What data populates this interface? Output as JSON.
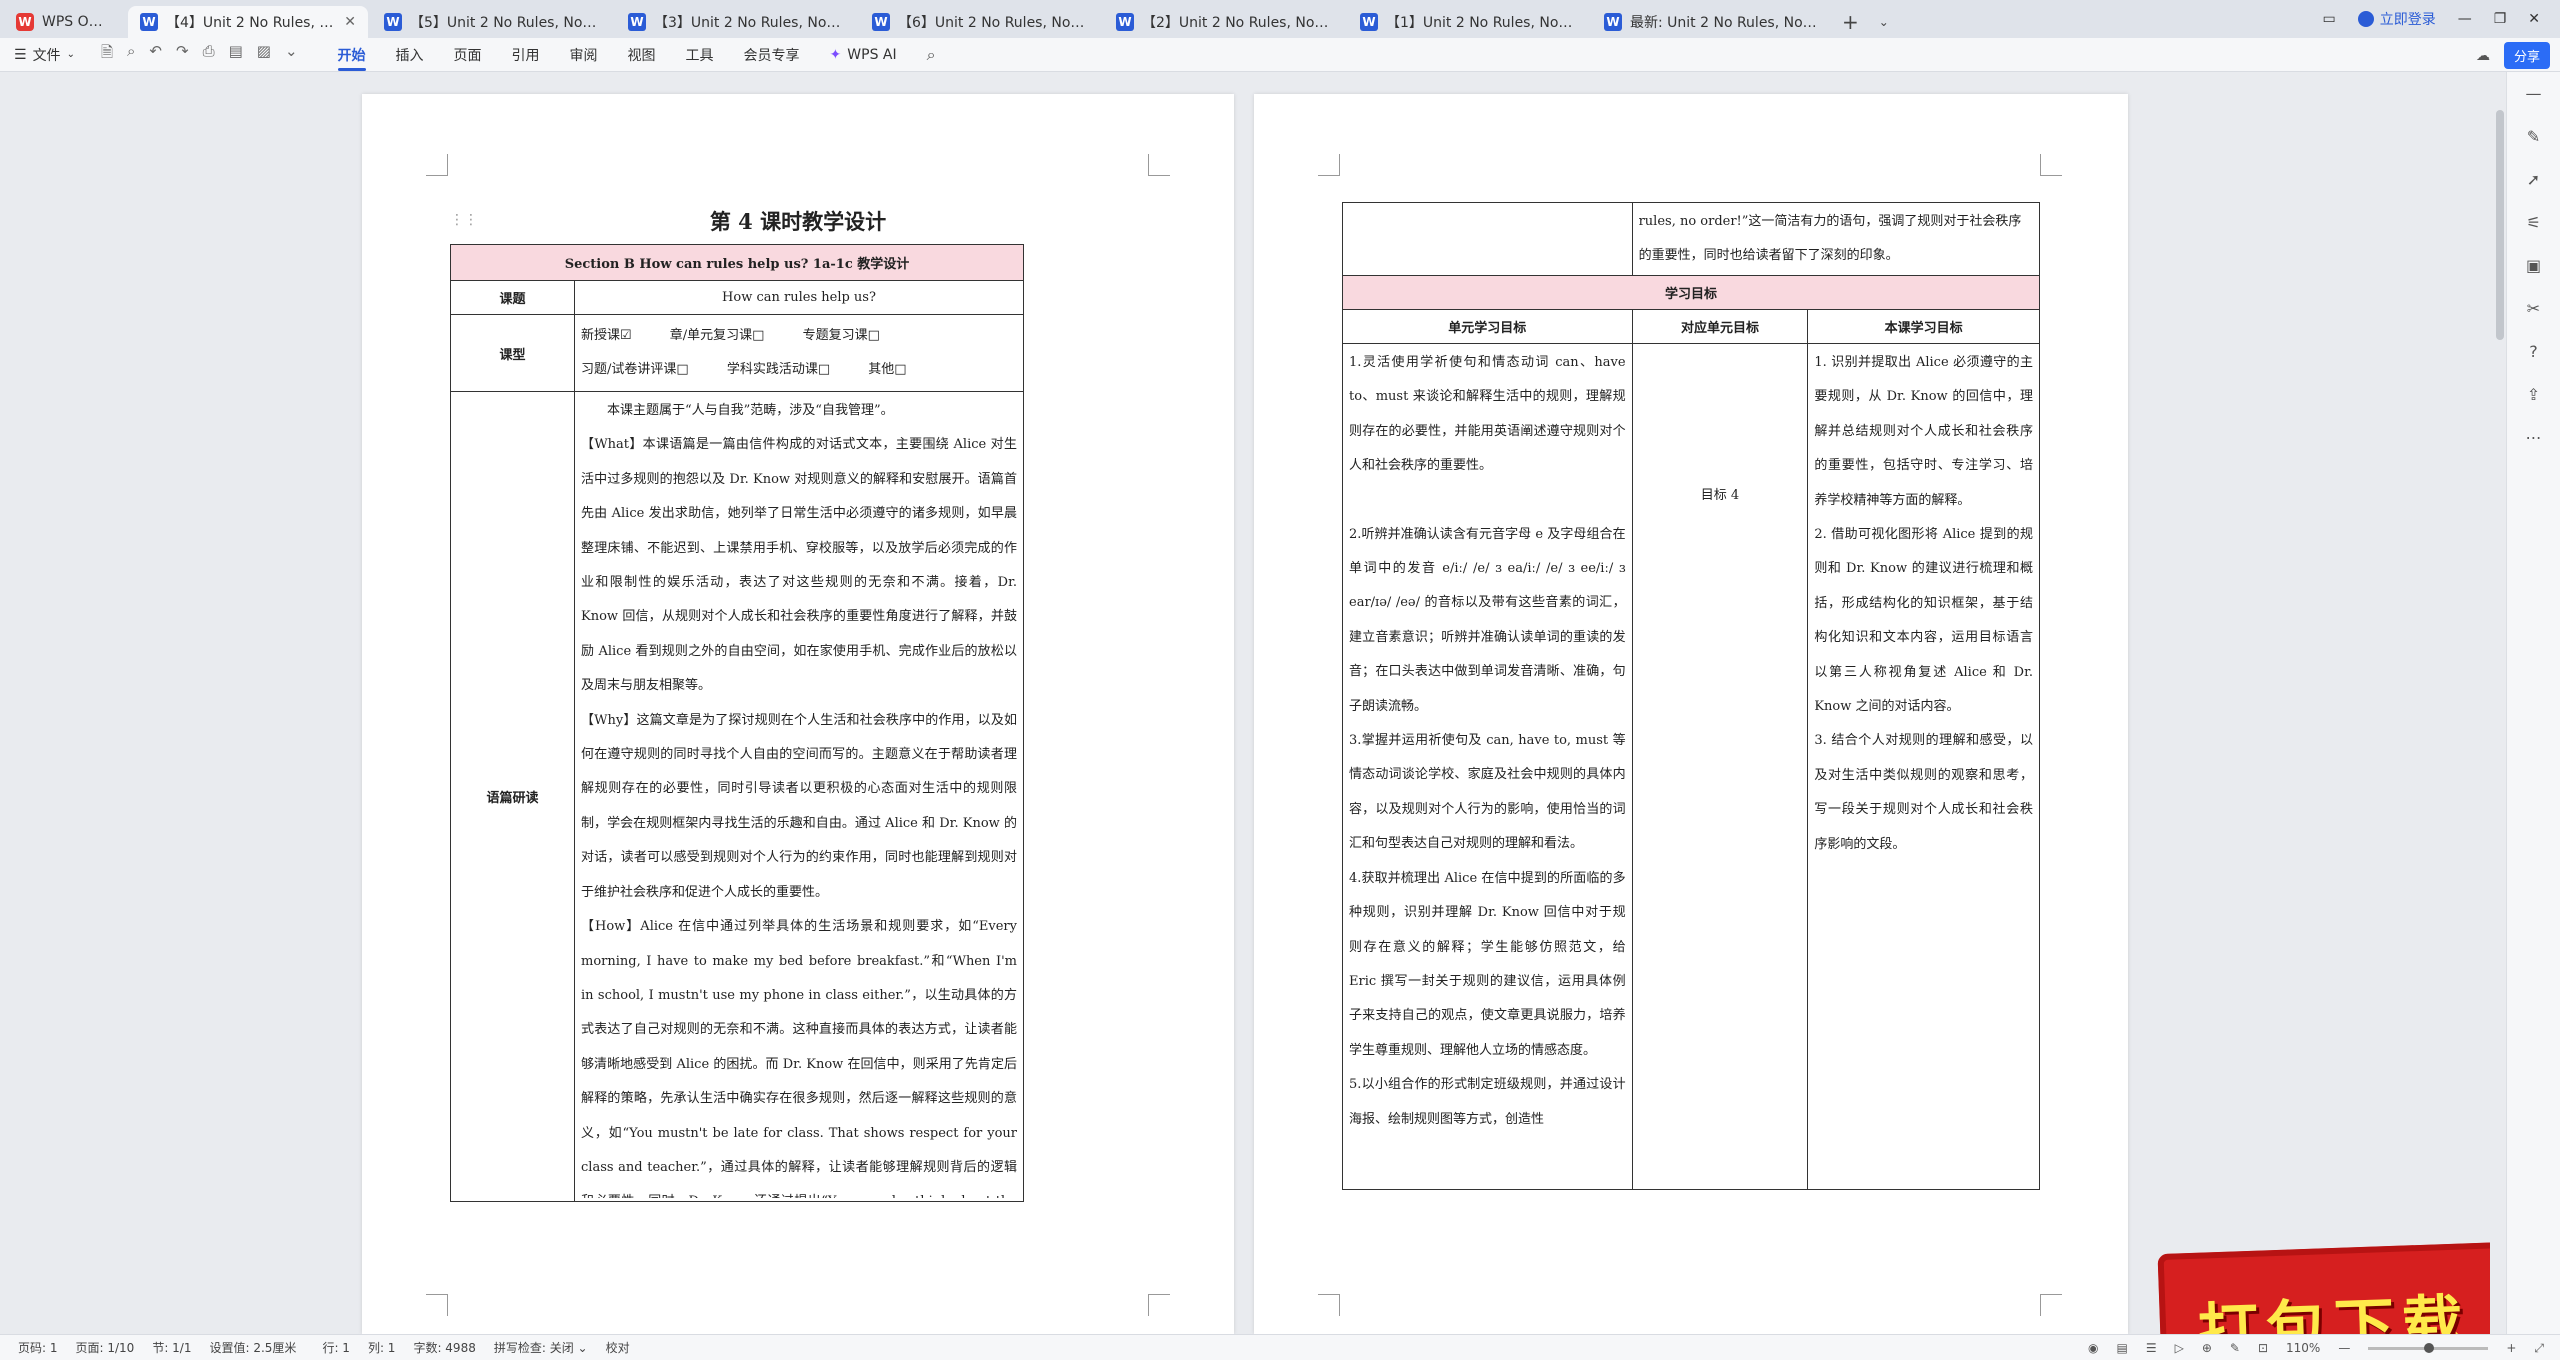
{
  "tabs": [
    {
      "label": "WPS Office",
      "kind": "app",
      "active": false
    },
    {
      "label": "【4】Unit 2 No Rules, No O",
      "kind": "doc",
      "active": true
    },
    {
      "label": "【5】Unit 2 No Rules, No Order",
      "kind": "doc",
      "active": false
    },
    {
      "label": "【3】Unit 2 No Rules, No Order",
      "kind": "doc",
      "active": false
    },
    {
      "label": "【6】Unit 2 No Rules, No Order",
      "kind": "doc",
      "active": false
    },
    {
      "label": "【2】Unit 2 No Rules, No Order",
      "kind": "doc",
      "active": false
    },
    {
      "label": "【1】Unit 2 No Rules, No Order",
      "kind": "doc",
      "active": false
    },
    {
      "label": "最新: Unit 2 No Rules, No Order",
      "kind": "doc",
      "active": false
    }
  ],
  "login_label": "立即登录",
  "share_label": "分享",
  "ribbon": {
    "file_label": "文件",
    "tabs": [
      "开始",
      "插入",
      "页面",
      "引用",
      "审阅",
      "视图",
      "工具",
      "会员专享"
    ],
    "active_tab": "开始",
    "ai_label": "WPS AI"
  },
  "page1": {
    "title": "第 4 课时教学设计",
    "table_header": "Section B How can rules help us? 1a-1c 教学设计",
    "topic_label": "课题",
    "topic_value": "How can rules help us?",
    "type_label": "课型",
    "type_line1": [
      "新授课☑",
      "章/单元复习课□",
      "专题复习课□"
    ],
    "type_line2": [
      "习题/试卷讲评课□",
      "学科实践活动课□",
      "其他□"
    ],
    "analysis_label": "语篇研读",
    "analysis_paragraphs": [
      "　　本课主题属于“人与自我”范畴，涉及“自我管理”。",
      "【What】本课语篇是一篇由信件构成的对话式文本，主要围绕 Alice 对生活中过多规则的抱怨以及 Dr. Know 对规则意义的解释和安慰展开。语篇首先由 Alice 发出求助信，她列举了日常生活中必须遵守的诸多规则，如早晨整理床铺、不能迟到、上课禁用手机、穿校服等，以及放学后必须完成的作业和限制性的娱乐活动，表达了对这些规则的无奈和不满。接着，Dr. Know 回信，从规则对个人成长和社会秩序的重要性角度进行了解释，并鼓励 Alice 看到规则之外的自由空间，如在家使用手机、完成作业后的放松以及周末与朋友相聚等。",
      "【Why】这篇文章是为了探讨规则在个人生活和社会秩序中的作用，以及如何在遵守规则的同时寻找个人自由的空间而写的。主题意义在于帮助读者理解规则存在的必要性，同时引导读者以更积极的心态面对生活中的规则限制，学会在规则框架内寻找生活的乐趣和自由。通过 Alice 和 Dr. Know 的对话，读者可以感受到规则对个人行为的约束作用，同时也能理解到规则对于维护社会秩序和促进个人成长的重要性。",
      "【How】Alice 在信中通过列举具体的生活场景和规则要求，如“Every morning, I have to make my bed before breakfast.”和“When I'm in school, I mustn't use my phone in class either.”，以生动具体的方式表达了自己对规则的无奈和不满。这种直接而具体的表达方式，让读者能够清晰地感受到 Alice 的困扰。而 Dr. Know 在回信中，则采用了先肯定后解释的策略，先承认生活中确实存在很多规则，然后逐一解释这些规则的意义，如“You mustn't be late for class. That shows respect for your class and teacher.”，通过具体的解释，让读者能够理解规则背后的逻辑和必要性。同时，Dr. Know 还通过提出“You can also think about the things you can do!”来引导 Alice 看到规则之外的自由空间，这种积极的引导方式，让读者能够在理解规则的同时，也学会在规则框架内寻找生活的乐趣和自由。在结尾部分，Dr. Know 通过“Remember: No"
    ]
  },
  "page2": {
    "continued_text": "rules, no order!”这一简洁有力的语句，强调了规则对于社会秩序的重要性，同时也给读者留下了深刻的印象。",
    "section_title": "学习目标",
    "col1_header": "单元学习目标",
    "col2_header": "对应单元目标",
    "col3_header": "本课学习目标",
    "unit_goals": [
      "1.灵活使用学祈使句和情态动词 can、have to、must 来谈论和解释生活中的规则，理解规则存在的必要性，并能用英语阐述遵守规则对个人和社会秩序的重要性。",
      "",
      "2.听辨并准确认读含有元音字母 e 及字母组合在单词中的发音 e/iː/ /e/ ɜ ea/iː/ /e/ ɜ ee/iː/ ɜ ear/ɪə/ /eə/ 的音标以及带有这些音素的词汇，建立音素意识；听辨并准确认读单词的重读的发音；在口头表达中做到单词发音清晰、准确，句子朗读流畅。",
      "3.掌握并运用祈使句及 can, have to, must 等情态动词谈论学校、家庭及社会中规则的具体内容，以及规则对个人行为的影响，使用恰当的词汇和句型表达自己对规则的理解和看法。",
      "4.获取并梳理出 Alice 在信中提到的所面临的多种规则，识别并理解 Dr. Know 回信中对于规则存在意义的解释；学生能够仿照范文，给 Eric 撰写一封关于规则的建议信，运用具体例子来支持自己的观点，使文章更具说服力，培养学生尊重规则、理解他人立场的情感态度。",
      "5.以小组合作的形式制定班级规则，并通过设计海报、绘制规则图等方式，创造性"
    ],
    "corresponding_goal": "目标 4",
    "lesson_goals": [
      "1. 识别并提取出 Alice 必须遵守的主要规则，从 Dr. Know 的回信中，理解并总结规则对个人成长和社会秩序的重要性，包括守时、专注学习、培养学校精神等方面的解释。",
      "2. 借助可视化图形将 Alice 提到的规则和 Dr. Know 的建议进行梳理和概括，形成结构化的知识框架，基于结构化知识和文本内容，运用目标语言以第三人称视角复述 Alice 和 Dr. Know 之间的对话内容。",
      "3. 结合个人对规则的理解和感受，以及对生活中类似规则的观察和思考，写一段关于规则对个人成长和社会秩序影响的文段。"
    ]
  },
  "statusbar": {
    "page_num": "页码: 1",
    "pages": "页面: 1/10",
    "section": "节: 1/1",
    "setting": "设置值: 2.5厘米",
    "row": "行: 1",
    "col": "列: 1",
    "word_count": "字数: 4988",
    "spell_check": "拼写检查: 关闭",
    "proofread": "校对",
    "zoom": "110%"
  },
  "badge_text": "打包下载"
}
